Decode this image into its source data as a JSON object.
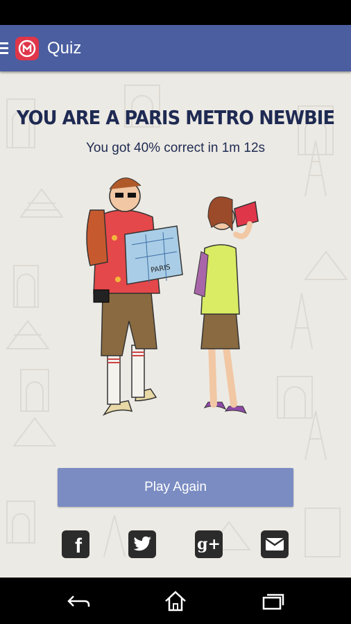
{
  "app_bar": {
    "title": "Quiz",
    "icons": [
      "menu-icon",
      "metro-logo-icon"
    ],
    "color": "#4a5ea0"
  },
  "result": {
    "headline": "YOU ARE A PARIS METRO NEWBIE",
    "score_text": "You got 40% correct in 1m 12s"
  },
  "illustration": {
    "map_text": "PARIS"
  },
  "actions": {
    "play_again_label": "Play Again",
    "button_color": "#7a8cc2"
  },
  "share": {
    "facebook_glyph": "f",
    "google_plus_glyph": "g+",
    "icons": [
      "facebook-icon",
      "twitter-icon",
      "google-plus-icon",
      "email-icon"
    ]
  },
  "nav": {
    "icons": [
      "back-icon",
      "home-icon",
      "recents-icon"
    ]
  }
}
